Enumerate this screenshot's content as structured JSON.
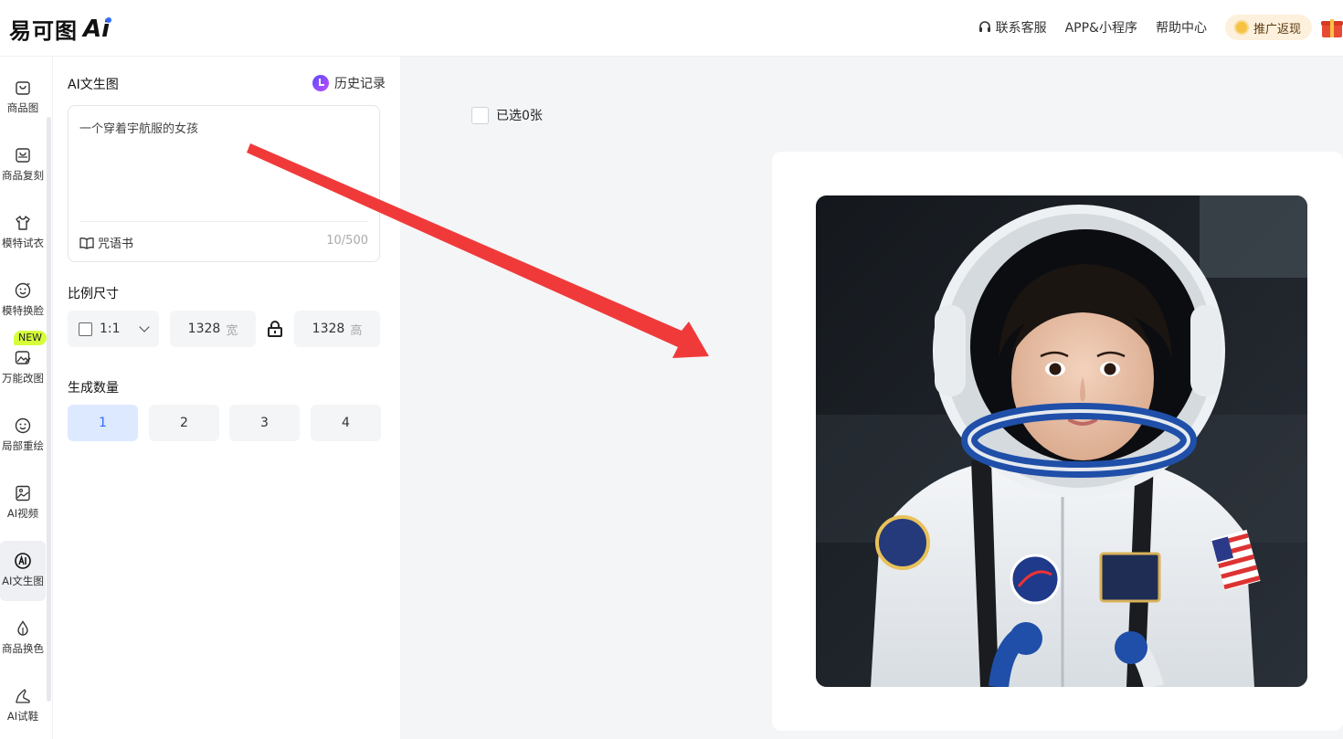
{
  "header": {
    "logo_text": "易可图",
    "logo_ai": "Ai",
    "links": {
      "service": "联系客服",
      "app": "APP&小程序",
      "help": "帮助中心"
    },
    "promo": "推广返现"
  },
  "nav": {
    "items": [
      {
        "label": "商品图",
        "icon": "shopping-bag-icon"
      },
      {
        "label": "商品复刻",
        "icon": "copy-bag-icon"
      },
      {
        "label": "模特试衣",
        "icon": "tshirt-icon"
      },
      {
        "label": "模特换脸",
        "icon": "face-swap-icon"
      },
      {
        "label": "万能改图",
        "icon": "image-edit-icon"
      },
      {
        "label": "局部重绘",
        "icon": "face-icon"
      },
      {
        "label": "AI视频",
        "icon": "video-image-icon"
      },
      {
        "label": "AI文生图",
        "icon": "ai-circle-icon"
      },
      {
        "label": "商品换色",
        "icon": "color-drop-icon"
      },
      {
        "label": "AI试鞋",
        "icon": "shoe-icon"
      }
    ],
    "active_index": 7,
    "new_badge": "NEW"
  },
  "panel": {
    "title": "AI文生图",
    "history": "历史记录",
    "prompt": "一个穿着宇航服的女孩",
    "spellbook": "咒语书",
    "counter": "10/500",
    "ratio_label": "比例尺寸",
    "ratio_value": "1:1",
    "width_value": "1328",
    "width_unit": "宽",
    "height_value": "1328",
    "height_unit": "高",
    "quantity_label": "生成数量",
    "quantity_options": [
      "1",
      "2",
      "3",
      "4"
    ],
    "quantity_selected": "1"
  },
  "main": {
    "selected_text": "已选0张"
  },
  "colors": {
    "accent": "#2f6bff",
    "arrow": "#f03a3a",
    "active_qty_bg": "#dde9ff",
    "new_badge": "#d6ff3a"
  }
}
